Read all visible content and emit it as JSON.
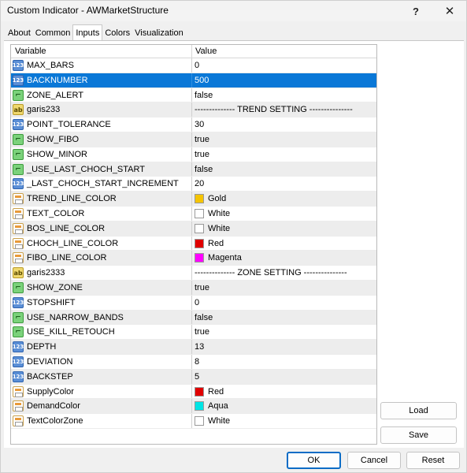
{
  "window": {
    "title": "Custom Indicator - AWMarketStructure"
  },
  "titlebar": {
    "help": "?",
    "close": "✕"
  },
  "tabs": [
    {
      "label": "About"
    },
    {
      "label": "Common"
    },
    {
      "label": "Inputs"
    },
    {
      "label": "Colors"
    },
    {
      "label": "Visualization"
    }
  ],
  "grid": {
    "header_variable": "Variable",
    "header_value": "Value",
    "rows": [
      {
        "type": "num",
        "name": "MAX_BARS",
        "value": "0"
      },
      {
        "type": "num",
        "name": "BACKNUMBER",
        "value": "500",
        "selected": true
      },
      {
        "type": "bool",
        "name": "ZONE_ALERT",
        "value": "false"
      },
      {
        "type": "str",
        "name": "garis233",
        "value": "-------------- TREND SETTING ---------------"
      },
      {
        "type": "num",
        "name": "POINT_TOLERANCE",
        "value": "30"
      },
      {
        "type": "bool",
        "name": "SHOW_FIBO",
        "value": "true"
      },
      {
        "type": "bool",
        "name": "SHOW_MINOR",
        "value": "true"
      },
      {
        "type": "bool",
        "name": "_USE_LAST_CHOCH_START",
        "value": "false"
      },
      {
        "type": "num",
        "name": "_LAST_CHOCH_START_INCREMENT",
        "value": "20"
      },
      {
        "type": "color",
        "name": "TREND_LINE_COLOR",
        "value": "Gold",
        "swatch": "#f5c400"
      },
      {
        "type": "color",
        "name": "TEXT_COLOR",
        "value": "White",
        "swatch": "#ffffff"
      },
      {
        "type": "color",
        "name": "BOS_LINE_COLOR",
        "value": "White",
        "swatch": "#ffffff"
      },
      {
        "type": "color",
        "name": "CHOCH_LINE_COLOR",
        "value": "Red",
        "swatch": "#e00000"
      },
      {
        "type": "color",
        "name": "FIBO_LINE_COLOR",
        "value": "Magenta",
        "swatch": "#ff00ff"
      },
      {
        "type": "str",
        "name": "garis2333",
        "value": "-------------- ZONE SETTING ---------------"
      },
      {
        "type": "bool",
        "name": "SHOW_ZONE",
        "value": "true"
      },
      {
        "type": "num",
        "name": "STOPSHIFT",
        "value": "0"
      },
      {
        "type": "bool",
        "name": "USE_NARROW_BANDS",
        "value": "false"
      },
      {
        "type": "bool",
        "name": "USE_KILL_RETOUCH",
        "value": "true"
      },
      {
        "type": "num",
        "name": "DEPTH",
        "value": "13"
      },
      {
        "type": "num",
        "name": "DEVIATION",
        "value": "8"
      },
      {
        "type": "num",
        "name": "BACKSTEP",
        "value": "5"
      },
      {
        "type": "color",
        "name": "SupplyColor",
        "value": "Red",
        "swatch": "#e00000"
      },
      {
        "type": "color",
        "name": "DemandColor",
        "value": "Aqua",
        "swatch": "#00e5e5"
      },
      {
        "type": "color",
        "name": "TextColorZone",
        "value": "White",
        "swatch": "#ffffff"
      }
    ]
  },
  "buttons": {
    "load": "Load",
    "save": "Save",
    "ok": "OK",
    "cancel": "Cancel",
    "reset": "Reset"
  },
  "colors": {
    "selection": "#0a78d7",
    "accent": "#0a6cc6"
  },
  "icons": {
    "num": "123",
    "bool": "⌐",
    "str": "ab"
  }
}
